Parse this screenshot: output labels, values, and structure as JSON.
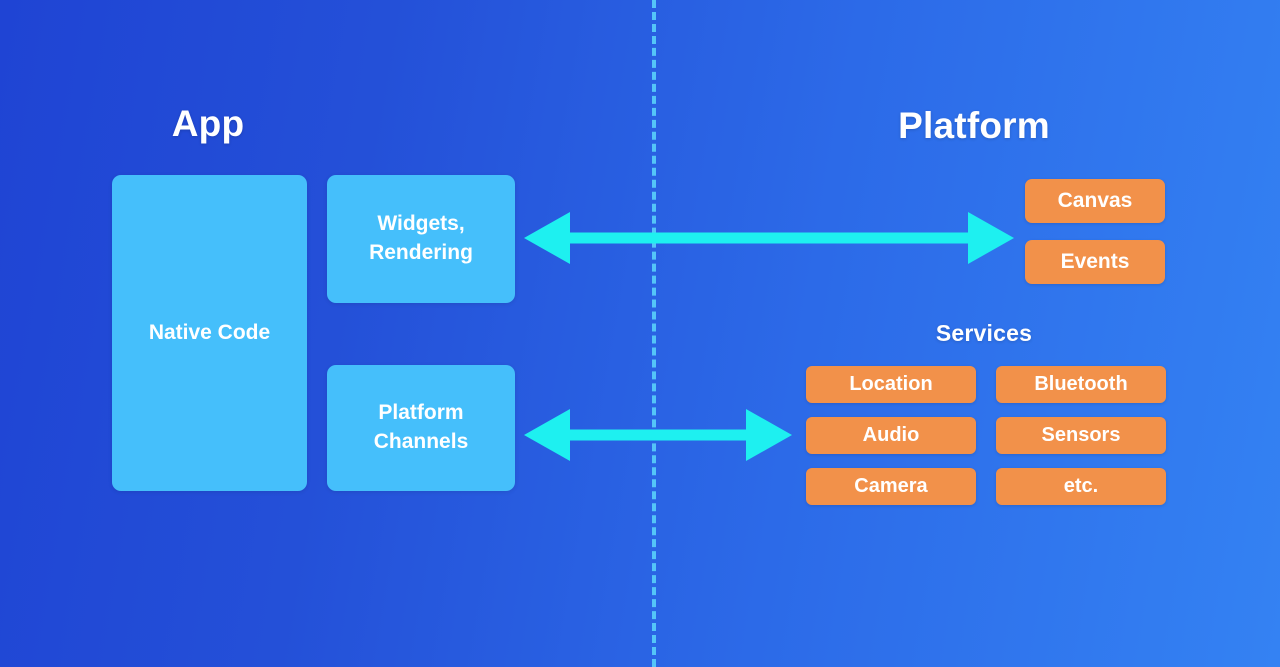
{
  "diagram": {
    "title_left": "App",
    "title_right": "Platform",
    "divider": {
      "name": "dashed-boundary",
      "color": "#54c5f8",
      "style": "dashed-vertical"
    },
    "colors": {
      "background_left": "#1f44d4",
      "background_right": "#3482f3",
      "app_box": "#45bffb",
      "platform_box": "#f2914a",
      "arrow": "#1ef0f0",
      "divider": "#54c5f8",
      "text": "#ffffff"
    }
  },
  "app": {
    "title": "App",
    "native_code": "Native Code",
    "widgets_rendering": "Widgets,\nRendering",
    "widgets_rendering_line1": "Widgets,",
    "widgets_rendering_line2": "Rendering",
    "platform_channels_line1": "Platform",
    "platform_channels_line2": "Channels"
  },
  "platform": {
    "title": "Platform",
    "boxes": [
      {
        "label": "Canvas"
      },
      {
        "label": "Events"
      }
    ],
    "services": {
      "heading": "Services",
      "items": [
        {
          "label": "Location"
        },
        {
          "label": "Bluetooth"
        },
        {
          "label": "Audio"
        },
        {
          "label": "Sensors"
        },
        {
          "label": "Camera"
        },
        {
          "label": "etc."
        }
      ]
    }
  },
  "connections": [
    {
      "name": "rendering-channel",
      "from": "Widgets, Rendering",
      "to": "Canvas / Events",
      "direction": "bidirectional"
    },
    {
      "name": "platform-channel",
      "from": "Platform Channels",
      "to": "Services",
      "direction": "bidirectional"
    }
  ]
}
